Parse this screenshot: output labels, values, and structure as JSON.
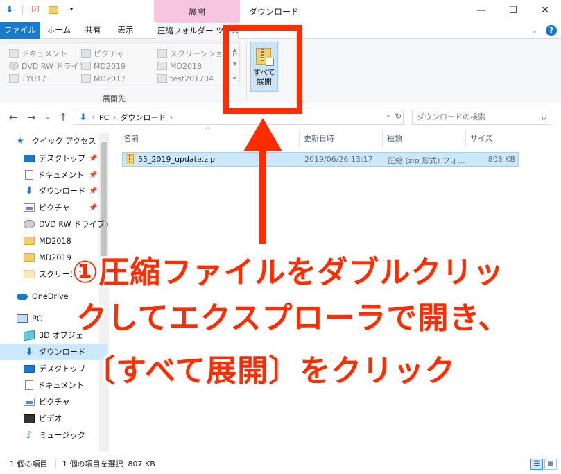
{
  "title_bar": {
    "context_tab_header": "展開",
    "window_title": "ダウンロード",
    "minimize": "—",
    "maximize": "☐",
    "close": "✕"
  },
  "ribbon_tabs": {
    "file": "ファイル",
    "home": "ホーム",
    "share": "共有",
    "view": "表示",
    "compressed_tools": "圧縮フォルダー ツール"
  },
  "ribbon": {
    "gallery": [
      {
        "label": "ドキュメント",
        "icon": "document-icon"
      },
      {
        "label": "ピクチャ",
        "icon": "picture-icon"
      },
      {
        "label": "スクリーンショット",
        "icon": "document-icon"
      },
      {
        "label": "DVD RW ドライブ",
        "icon": "drive-icon"
      },
      {
        "label": "MD2019",
        "icon": "folder-icon"
      },
      {
        "label": "MD2018",
        "icon": "folder-icon"
      },
      {
        "label": "TYU17",
        "icon": "folder-icon"
      },
      {
        "label": "MD2017",
        "icon": "folder-icon"
      },
      {
        "label": "test201704",
        "icon": "folder-icon"
      }
    ],
    "group_label": "展開先",
    "extract_all_line1": "すべて",
    "extract_all_line2": "展開"
  },
  "address": {
    "segments": [
      "PC",
      "ダウンロード"
    ],
    "search_placeholder": "ダウンロードの検索"
  },
  "nav_pane": {
    "items": [
      {
        "label": "クイック アクセス",
        "icon": "star-icon",
        "pinned": false
      },
      {
        "label": "デスクトップ",
        "icon": "desktop-icon",
        "pinned": true
      },
      {
        "label": "ドキュメント",
        "icon": "document-icon",
        "pinned": true
      },
      {
        "label": "ダウンロード",
        "icon": "download-icon",
        "pinned": true
      },
      {
        "label": "ピクチャ",
        "icon": "picture-icon",
        "pinned": true
      },
      {
        "label": "DVD RW ドライブ (",
        "icon": "drive-icon",
        "pinned": false
      },
      {
        "label": "MD2018",
        "icon": "folder-icon",
        "pinned": false
      },
      {
        "label": "MD2019",
        "icon": "folder-icon",
        "pinned": false
      },
      {
        "label": "スクリーンシ",
        "icon": "folder-icon",
        "pinned": false
      },
      {
        "label": "OneDrive",
        "icon": "cloud-icon",
        "pinned": false
      },
      {
        "label": "PC",
        "icon": "pc-icon",
        "pinned": false
      },
      {
        "label": "3D オブジェ",
        "icon": "3d-objects-icon",
        "pinned": false
      },
      {
        "label": "ダウンロード",
        "icon": "download-icon",
        "pinned": false,
        "selected": true
      },
      {
        "label": "デスクトップ",
        "icon": "desktop-icon",
        "pinned": false
      },
      {
        "label": "ドキュメント",
        "icon": "document-icon",
        "pinned": false
      },
      {
        "label": "ピクチャ",
        "icon": "picture-icon",
        "pinned": false
      },
      {
        "label": "ビデオ",
        "icon": "video-icon",
        "pinned": false
      },
      {
        "label": "ミュージック",
        "icon": "music-icon",
        "pinned": false
      }
    ]
  },
  "file_list": {
    "columns": [
      "名前",
      "更新日時",
      "種類",
      "サイズ"
    ],
    "rows": [
      {
        "name": "55_2019_update.zip",
        "modified": "2019/06/26 13:17",
        "type": "圧縮 (zip 形式) フォ...",
        "size": "808 KB"
      }
    ]
  },
  "status_bar": {
    "item_count": "1 個の項目",
    "selection": "1 個の項目を選択  807 KB"
  },
  "annotation": {
    "line1": "①圧縮ファイルをダブルクリッ",
    "line2": "クしてエクスプローラで開き、",
    "line3": "〔すべて展開〕をクリック",
    "color": "#ff2d00"
  }
}
